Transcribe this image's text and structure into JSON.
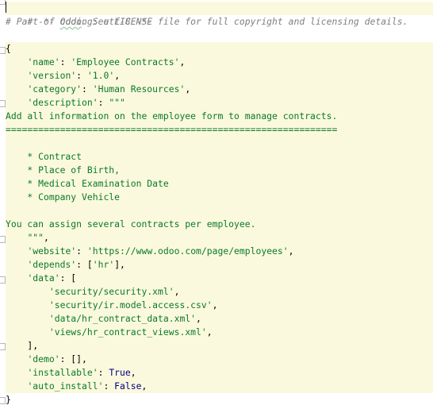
{
  "editor": {
    "lines": [
      {
        "type": "comment",
        "text": "# -*- coding: utf-8 -*-"
      },
      {
        "type": "comment-odoo",
        "pre": "# Part of ",
        "word": "Odoo",
        "post": ". See LICENSE file for full copyright and licensing details."
      },
      {
        "type": "blank"
      },
      {
        "type": "plain",
        "text": "{"
      },
      {
        "type": "kv",
        "indent": "    ",
        "key": "'name'",
        "sep": ": ",
        "value": "'Employee Contracts'",
        "end": ","
      },
      {
        "type": "kv",
        "indent": "    ",
        "key": "'version'",
        "sep": ": ",
        "value": "'1.0'",
        "end": ","
      },
      {
        "type": "kv",
        "indent": "    ",
        "key": "'category'",
        "sep": ": ",
        "value": "'Human Resources'",
        "end": ","
      },
      {
        "type": "kv",
        "indent": "    ",
        "key": "'description'",
        "sep": ": ",
        "value": "\"\"\"",
        "end": ""
      },
      {
        "type": "str",
        "text": "Add all information on the employee form to manage contracts."
      },
      {
        "type": "str",
        "text": "============================================================="
      },
      {
        "type": "blank"
      },
      {
        "type": "str",
        "text": "    * Contract"
      },
      {
        "type": "str",
        "text": "    * Place of Birth,"
      },
      {
        "type": "str",
        "text": "    * Medical Examination Date"
      },
      {
        "type": "str",
        "text": "    * Company Vehicle"
      },
      {
        "type": "blank"
      },
      {
        "type": "str",
        "text": "You can assign several contracts per employee."
      },
      {
        "type": "strend",
        "indent": "    ",
        "value": "\"\"\"",
        "end": ","
      },
      {
        "type": "kv",
        "indent": "    ",
        "key": "'website'",
        "sep": ": ",
        "value": "'https://www.odoo.com/page/employees'",
        "end": ","
      },
      {
        "type": "kv",
        "indent": "    ",
        "key": "'depends'",
        "sep": ": [",
        "value": "'hr'",
        "end": "],"
      },
      {
        "type": "kv",
        "indent": "    ",
        "key": "'data'",
        "sep": ": [",
        "value": "",
        "end": ""
      },
      {
        "type": "strend",
        "indent": "        ",
        "value": "'security/security.xml'",
        "end": ","
      },
      {
        "type": "strend",
        "indent": "        ",
        "value": "'security/ir.model.access.csv'",
        "end": ","
      },
      {
        "type": "strend",
        "indent": "        ",
        "value": "'data/hr_contract_data.xml'",
        "end": ","
      },
      {
        "type": "strend",
        "indent": "        ",
        "value": "'views/hr_contract_views.xml'",
        "end": ","
      },
      {
        "type": "plain",
        "text": "    ],"
      },
      {
        "type": "kv",
        "indent": "    ",
        "key": "'demo'",
        "sep": ": [],",
        "value": "",
        "end": ""
      },
      {
        "type": "kvkw",
        "indent": "    ",
        "key": "'installable'",
        "sep": ": ",
        "value": "True",
        "end": ","
      },
      {
        "type": "kvkw",
        "indent": "    ",
        "key": "'auto_install'",
        "sep": ": ",
        "value": "False",
        "end": ","
      },
      {
        "type": "plain",
        "text": "}"
      }
    ]
  },
  "colors": {
    "current_block_bg": "#fbf9dd",
    "string": "#0a7a2a",
    "comment": "#808080",
    "keyword": "#000080"
  },
  "icons": [
    "fold-marker-icon"
  ]
}
